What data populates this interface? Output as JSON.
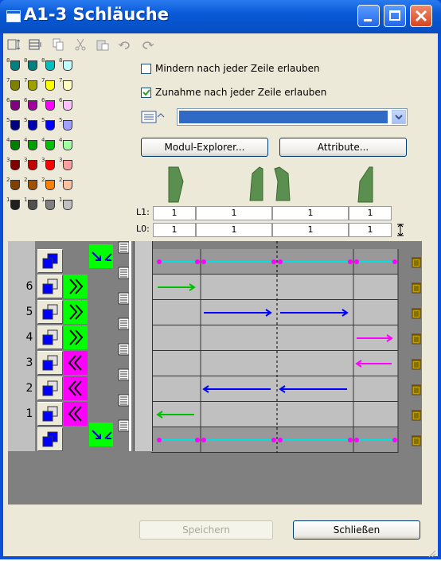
{
  "window": {
    "title": "A1-3 Schläuche"
  },
  "swatches": [
    {
      "n": "8",
      "colors": [
        "#008080",
        "#008080",
        "#00c0c0",
        "#c0ffff"
      ]
    },
    {
      "n": "7",
      "colors": [
        "#808000",
        "#a0a000",
        "#ffff00",
        "#ffffc0"
      ]
    },
    {
      "n": "6",
      "colors": [
        "#800080",
        "#a000a0",
        "#ff00ff",
        "#ffc0ff"
      ]
    },
    {
      "n": "5",
      "colors": [
        "#000080",
        "#0000b0",
        "#0000ff",
        "#a0a0ff"
      ]
    },
    {
      "n": "4",
      "colors": [
        "#008000",
        "#00a000",
        "#00c000",
        "#a0ffa0"
      ]
    },
    {
      "n": "3",
      "colors": [
        "#800000",
        "#c00000",
        "#ff0000",
        "#ffa0a0"
      ]
    },
    {
      "n": "2",
      "colors": [
        "#804000",
        "#a05000",
        "#ff8000",
        "#ffc0a0"
      ]
    },
    {
      "n": "1",
      "colors": [
        "#202020",
        "#505050",
        "#808080",
        "#c0c0c0"
      ]
    }
  ],
  "options": {
    "mindern_label": "Mindern nach jeder Zeile erlauben",
    "mindern_checked": false,
    "zunahme_label": "Zunahme nach jeder Zeile erlauben",
    "zunahme_checked": true
  },
  "buttons": {
    "modul_explorer": "Modul-Explorer...",
    "attribute": "Attribute...",
    "speichern": "Speichern",
    "schliessen": "Schließen"
  },
  "header": {
    "l1_label": "L1:",
    "l0_label": "L0:",
    "l1_values": [
      "1",
      "1",
      "1",
      "1"
    ],
    "l0_values": [
      "1",
      "1",
      "1",
      "1"
    ]
  },
  "rows": [
    {
      "label": "",
      "kind": "top"
    },
    {
      "label": "6",
      "kind": "right-green"
    },
    {
      "label": "5",
      "kind": "right-green"
    },
    {
      "label": "4",
      "kind": "right-green"
    },
    {
      "label": "3",
      "kind": "left-magenta"
    },
    {
      "label": "2",
      "kind": "left-magenta"
    },
    {
      "label": "1",
      "kind": "left-magenta"
    },
    {
      "label": "",
      "kind": "bottom"
    }
  ],
  "colors": {
    "accent_green": "#00ff00",
    "accent_magenta": "#ff00ff",
    "arrow_blue": "#0000ff",
    "arrow_cyan": "#00ffff",
    "shape_green": "#5b8f4f"
  }
}
